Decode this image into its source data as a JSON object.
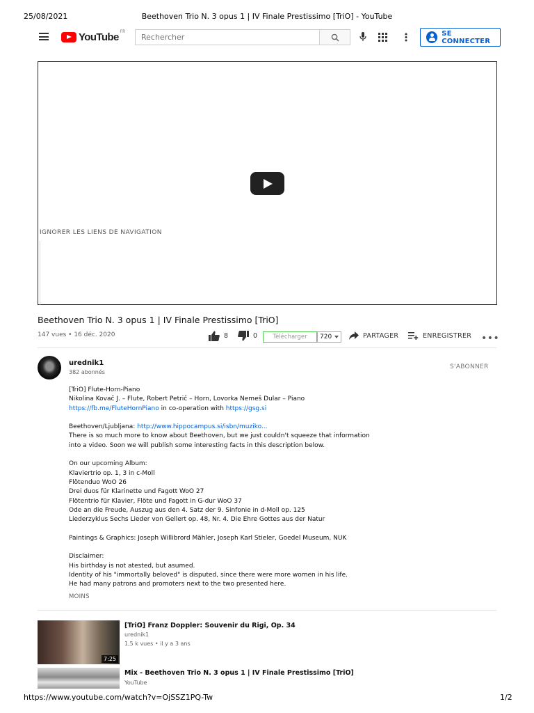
{
  "print": {
    "date": "25/08/2021",
    "page_title": "Beethoven Trio N. 3 opus 1 | IV Finale Prestissimo [TriO] - YouTube",
    "url": "https://www.youtube.com/watch?v=OjSSZ1PQ-Tw",
    "page_number": "1/2"
  },
  "header": {
    "logo_text": "YouTube",
    "region": "FR",
    "search_placeholder": "Rechercher",
    "signin_label": "SE CONNECTER"
  },
  "player": {
    "skip_nav_label": "IGNORER LES LIENS DE NAVIGATION"
  },
  "video": {
    "title": "Beethoven Trio N. 3 opus 1 | IV Finale Prestissimo [TriO]",
    "meta": "147 vues • 16 déc. 2020",
    "likes": "8",
    "dislikes": "0",
    "download_label": "Télécharger",
    "quality": "720",
    "share_label": "PARTAGER",
    "save_label": "ENREGISTRER"
  },
  "channel": {
    "name": "urednik1",
    "subscribers": "382 abonnés",
    "subscribe_label": "S'ABONNER"
  },
  "description": {
    "l1": "[TriO] Flute-Horn-Piano",
    "l2": "Nikolina Kovač J. – Flute, Robert Petrič – Horn, Lovorka Nemeš Dular – Piano",
    "l3_link1": "https://fb.me/FluteHornPiano",
    "l3_mid": " in co-operation with ",
    "l3_link2": "https://gsg.si",
    "l5_prefix": "Beethoven/Ljubljana: ",
    "l5_link": "http://www.hippocampus.si/isbn/muziko...",
    "l6": "There is so much more to know about Beethoven, but we just couldn't squeeze that information",
    "l7": "into a video. Soon we will publish some interesting facts in this description below.",
    "l9": "On our upcoming Album:",
    "l10": "Klaviertrio op. 1, 3 in c-Moll",
    "l11": "Flötenduo WoO 26",
    "l12": "Drei duos für Klarinette und Fagott WoO 27",
    "l13": "Flötentrio für Klavier, Flöte und Fagott in G-dur WoO 37",
    "l14": "Ode an die Freude, Auszug aus den 4. Satz der 9. Sinfonie in d-Moll op. 125",
    "l15": "Liederzyklus Sechs Lieder von Gellert op. 48, Nr. 4. Die Ehre Gottes aus der Natur",
    "l17": "Paintings & Graphics: Joseph Willibrord Mähler, Joseph Karl Stieler, Goedel Museum, NUK",
    "l19": "Disclaimer:",
    "l20": "His birthday is not atested, but asumed.",
    "l21": "Identity of his \"immortally beloved\" is disputed, since there were more women in his life.",
    "l22": "He had many patrons and promoters next to the two presented here.",
    "less_label": "MOINS"
  },
  "recommendations": [
    {
      "title": "[TriO] Franz Doppler: Souvenir du Rigi, Op. 34",
      "channel": "urednik1",
      "meta": "1,5 k vues • il y a 3 ans",
      "duration": "7:25"
    },
    {
      "title": "Mix - Beethoven Trio N. 3 opus 1 | IV Finale Prestissimo [TriO]",
      "channel": "YouTube"
    }
  ],
  "icons": [
    "menu-icon",
    "youtube-logo-icon",
    "search-icon",
    "mic-icon",
    "apps-icon",
    "more-vert-icon",
    "account-icon",
    "play-icon",
    "thumb-up-icon",
    "thumb-down-icon",
    "share-icon",
    "playlist-add-icon",
    "more-horiz-icon"
  ],
  "colors": {
    "brand_red": "#ff0000",
    "link_blue": "#065fd4"
  }
}
